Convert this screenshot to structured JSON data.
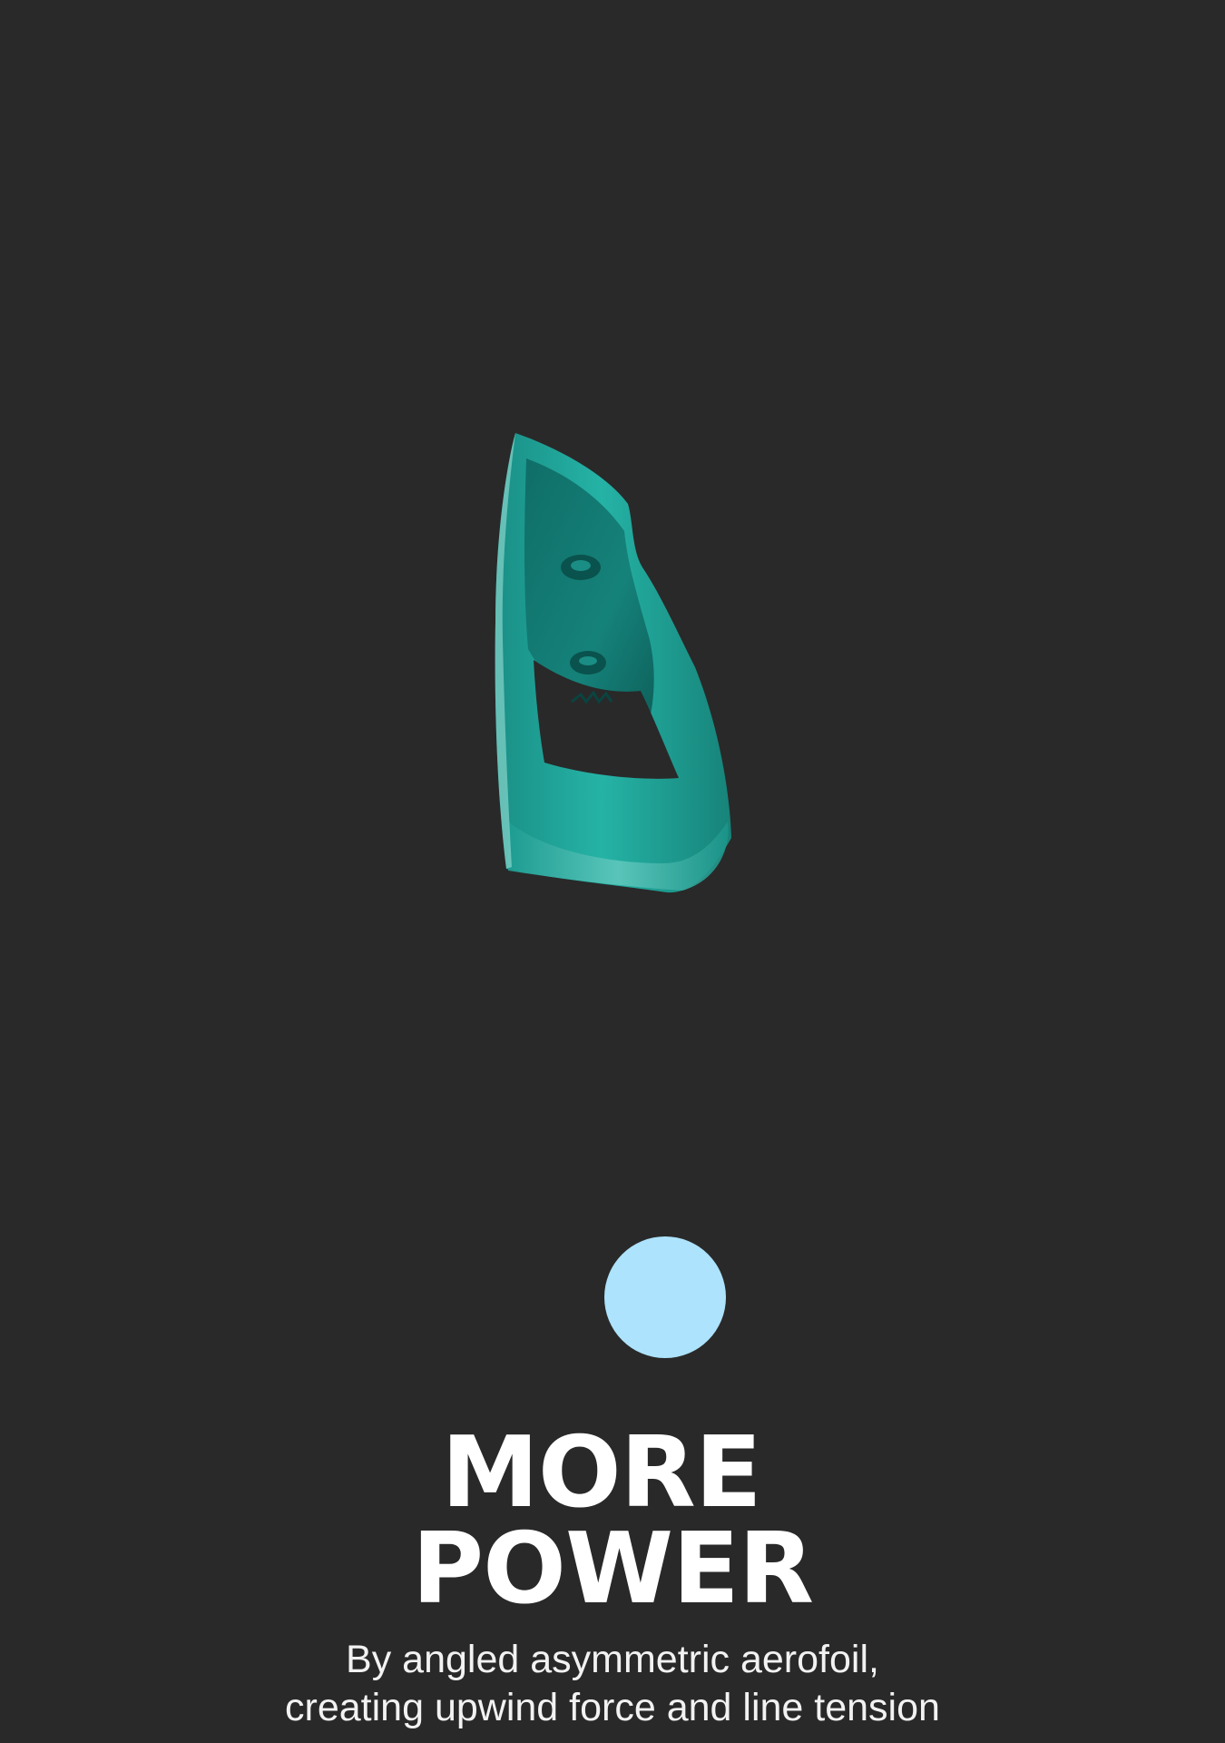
{
  "colors": {
    "background": "#292929",
    "accent_dot": "#ADE3FC",
    "product_teal": "#1FA79B",
    "text": "#FFFFFF"
  },
  "product": {
    "icon": "teal-aerofoil-handle-image"
  },
  "indicator": {
    "icon": "light-blue-circle-dot"
  },
  "headline": {
    "line1": "MORE",
    "line2": "POWER"
  },
  "description": {
    "line1": "By angled asymmetric aerofoil,",
    "line2": "creating upwind force and line tension"
  }
}
